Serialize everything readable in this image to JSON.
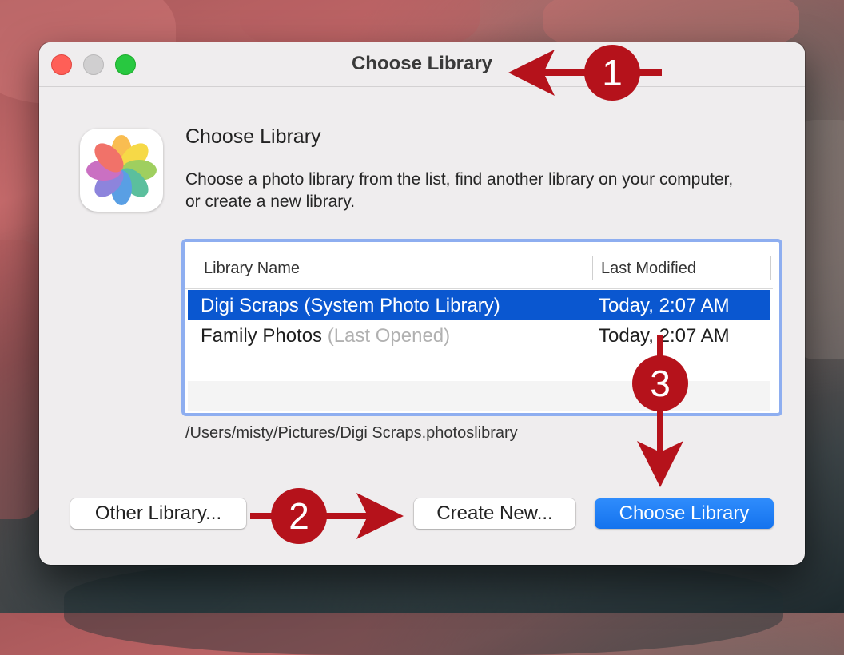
{
  "window": {
    "title": "Choose Library"
  },
  "dialog": {
    "heading": "Choose Library",
    "description": "Choose a photo library from the list, find another library on your computer, or create a new library.",
    "app_icon": "photos-app-icon"
  },
  "library_list": {
    "columns": [
      "Library Name",
      "Last Modified"
    ],
    "rows": [
      {
        "name": "Digi Scraps (System Photo Library)",
        "suffix": "",
        "modified": "Today, 2:07 AM",
        "selected": true
      },
      {
        "name": "Family Photos ",
        "suffix": "(Last Opened)",
        "modified": "Today, 2:07 AM",
        "selected": false
      }
    ]
  },
  "selected_path": "/Users/misty/Pictures/Digi Scraps.photoslibrary",
  "buttons": {
    "other": "Other Library...",
    "create": "Create New...",
    "choose": "Choose Library"
  },
  "annotations": {
    "color": "#b5121b",
    "labels": [
      "1",
      "2",
      "3"
    ]
  }
}
